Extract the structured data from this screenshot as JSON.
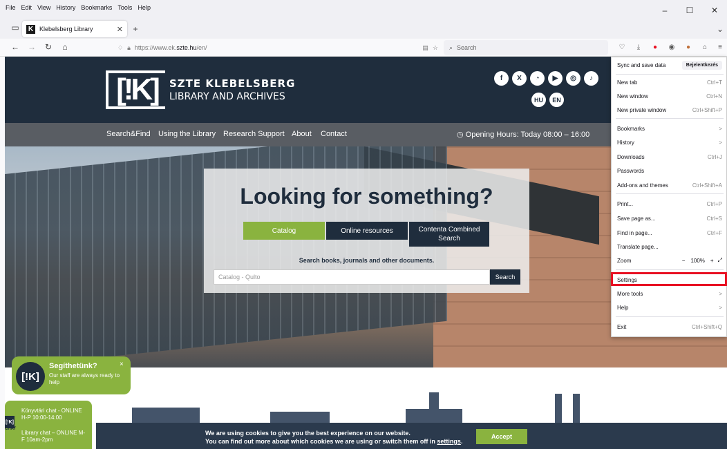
{
  "browser": {
    "menus": [
      "File",
      "Edit",
      "View",
      "History",
      "Bookmarks",
      "Tools",
      "Help"
    ],
    "tab_title": "Klebelsberg Library",
    "tab_favicon": "K",
    "url_prefix": "https://www.ek.",
    "url_domain": "szte.hu",
    "url_path": "/en/",
    "search_placeholder": "Search",
    "minimize": "–",
    "maximize": "☐",
    "close": "✕",
    "new_tab": "+",
    "tab_close": "✕",
    "overflow": "⌄"
  },
  "menu": {
    "sync": "Sync and save data",
    "sign_in": "Bejelentkezés",
    "new_tab": "New tab",
    "new_tab_sc": "Ctrl+T",
    "new_window": "New window",
    "new_window_sc": "Ctrl+N",
    "new_private": "New private window",
    "new_private_sc": "Ctrl+Shift+P",
    "bookmarks": "Bookmarks",
    "history": "History",
    "downloads": "Downloads",
    "downloads_sc": "Ctrl+J",
    "passwords": "Passwords",
    "addons": "Add-ons and themes",
    "addons_sc": "Ctrl+Shift+A",
    "print": "Print...",
    "print_sc": "Ctrl+P",
    "save": "Save page as...",
    "save_sc": "Ctrl+S",
    "find": "Find in page...",
    "find_sc": "Ctrl+F",
    "translate": "Translate page...",
    "zoom": "Zoom",
    "zoom_value": "100%",
    "zoom_minus": "−",
    "zoom_plus": "+",
    "settings": "Settings",
    "more_tools": "More tools",
    "help": "Help",
    "exit": "Exit",
    "exit_sc": "Ctrl+Shift+Q",
    "chevron": ">"
  },
  "site": {
    "logo_mark": "[!K]",
    "title_line1": "SZTE KLEBELSBERG",
    "title_line2": "LIBRARY AND ARCHIVES",
    "lang_hu": "HU",
    "lang_en": "EN",
    "nav": [
      "Search&Find",
      "Using the Library",
      "Research Support",
      "About",
      "Contact"
    ],
    "hours": "◷ Opening Hours:  Today 08:00 – 16:00",
    "hero_title": "Looking for something?",
    "btn_catalog": "Catalog",
    "btn_online": "Online resources",
    "btn_contenta": "Contenta Combined Search",
    "hint": "Search books, journals and other documents.",
    "input_placeholder": "Catalog - Qulto",
    "search_btn": "Search",
    "chat_title": "Segíthetünk?",
    "chat_sub": "Our staff are always ready to help",
    "chat_close": "×",
    "chat_logo": "[!K]",
    "chat_tag": "CHAT",
    "chat_hu": "Könyvtári chat - ONLINE H-P 10:00-14:00",
    "chat_en": "Library chat – ONLINE M-F 10am-2pm",
    "cookie_1": "We are using cookies to give you the best experience on our website.",
    "cookie_2a": "You can find out more about which cookies we are using or switch them off in ",
    "cookie_2b": "settings",
    "cookie_2c": ".",
    "accept": "Accept"
  },
  "colors": {
    "header": "#1f2d3d",
    "nav": "#595d63",
    "green": "#8ab33f",
    "highlight": "#e81123"
  }
}
